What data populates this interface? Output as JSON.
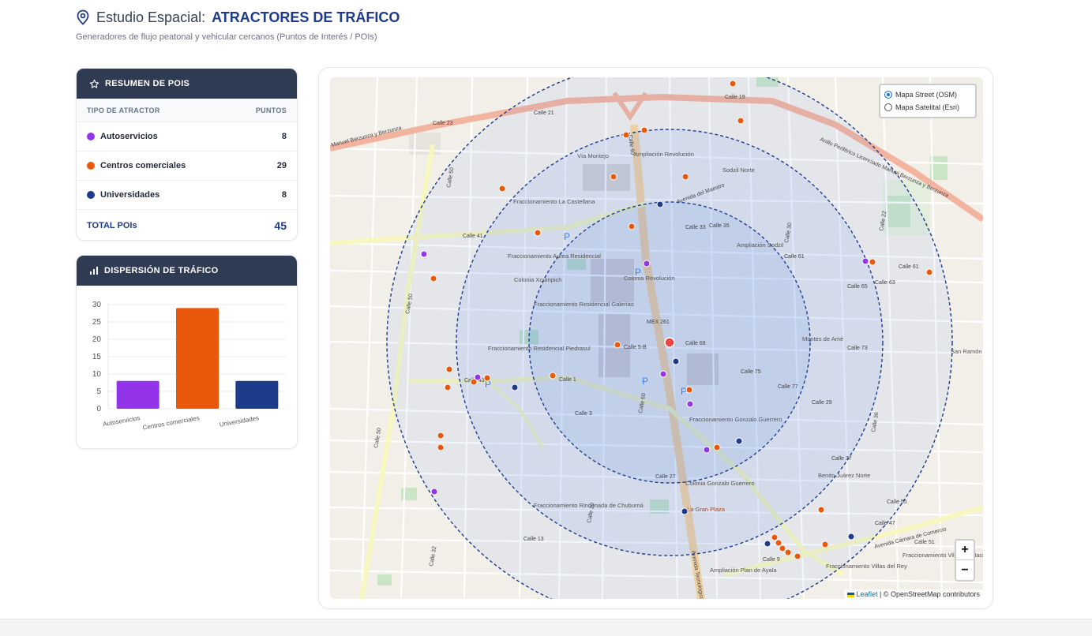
{
  "header": {
    "title_prefix": "Estudio Espacial:",
    "title_main": "ATRACTORES DE TRÁFICO",
    "subtitle": "Generadores de flujo peatonal y vehicular cercanos (Puntos de Interés / POIs)"
  },
  "summary": {
    "title": "RESUMEN DE POIS",
    "col_type": "TIPO DE ATRACTOR",
    "col_points": "PUNTOS",
    "rows": [
      {
        "label": "Autoservicios",
        "value": "8",
        "color": "#9333ea"
      },
      {
        "label": "Centros comerciales",
        "value": "29",
        "color": "#ea580c"
      },
      {
        "label": "Universidades",
        "value": "8",
        "color": "#1e3a8a"
      }
    ],
    "total_label": "TOTAL POIs",
    "total_value": "45"
  },
  "dispersion": {
    "title": "DISPERSIÓN DE TRÁFICO"
  },
  "chart_data": {
    "type": "bar",
    "categories": [
      "Autoservicios",
      "Centros comerciales",
      "Universidades"
    ],
    "values": [
      8,
      29,
      8
    ],
    "colors": [
      "#9333ea",
      "#ea580c",
      "#1e3a8a"
    ],
    "ylim": [
      0,
      30
    ],
    "yticks": [
      0,
      5,
      10,
      15,
      20,
      25,
      30
    ],
    "grid": true
  },
  "map": {
    "layers": [
      {
        "label": "Mapa Street (OSM)",
        "selected": true
      },
      {
        "label": "Mapa Satelital (Esri)",
        "selected": false
      }
    ],
    "zoom_in": "+",
    "zoom_out": "−",
    "attribution_link": "Leaflet",
    "attribution_text": "| © OpenStreetMap contributors",
    "labels": {
      "via_montejo": "Vía Montejo",
      "ampliacion_revolucion": "Ampliación Revolución",
      "sodzil_norte": "Sodzil Norte",
      "castellana": "Fraccionamiento La Castellana",
      "aurea": "Fraccionamiento Aurea Residencial",
      "xcumpich": "Colonia Xcumpich",
      "revolucion": "Colonia Revolución",
      "amp_sodzil": "Ampliación Sodzil",
      "galerias": "Fraccionamiento Residencial Galerías",
      "piedrasul": "Fraccionamiento Residencial Piedrasul",
      "montes_ame": "Montes de Amé",
      "gonzalo_guerrero": "Fraccionamiento Gonzalo Guerrero",
      "col_gonzalo": "Colonia Gonzalo Guerrero",
      "benito": "Benito Juárez Norte",
      "rinconada": "Fraccionamiento Rinconada de Chuburná",
      "plan_ayala": "Ampliación Plan de Ayala",
      "villas_rey": "Fraccionamiento Villas del Rey",
      "hacienda": "Fraccionamiento Villas La Hacienda",
      "san_ramon": "San Ramón Norte",
      "mex261": "MEX 261",
      "periferico": "Anillo Periférico Licenciado Manuel Berzunza y Berzunza",
      "berzunza": "Manuel Berzunza y Berzunza",
      "av_maestro": "Avenida del Maestro",
      "camara": "Avenida Cámara de Comercio",
      "tecnologico": "Avenida Tecnológico",
      "gran_plaza": "La Gran Plaza",
      "calle_41": "Calle 41",
      "calle_60": "Calle 60",
      "calle_50": "Calle 50",
      "calle_21": "Calle 21",
      "calle_23": "Calle 23",
      "calle_19": "Calle 19",
      "calle_43": "Calle 43",
      "calle_9": "Calle 9",
      "calle_1": "Calle 1",
      "calle_13": "Calle 13",
      "calle_61": "Calle 61",
      "calle_63": "Calle 63",
      "calle_29": "Calle 29",
      "calle_75": "Calle 75",
      "calle_22": "Calle 22",
      "calle_30": "Calle 30",
      "calle_32": "Calle 32",
      "calle_36": "Calle 36",
      "calle_20": "Calle 20",
      "calle_37": "Calle 37",
      "calle_47": "Calle 47",
      "calle_5b": "Calle 5-B",
      "calle_3": "Calle 3",
      "calle_27": "Calle 27",
      "calle_69": "Calle 69",
      "calle_73": "Calle 73",
      "calle_77": "Calle 77",
      "calle_51": "Calle 51",
      "calle_55": "Calle 55",
      "calle_33": "Calle 33",
      "calle_35": "Calle 35",
      "calle_65": "Calle 65"
    }
  }
}
